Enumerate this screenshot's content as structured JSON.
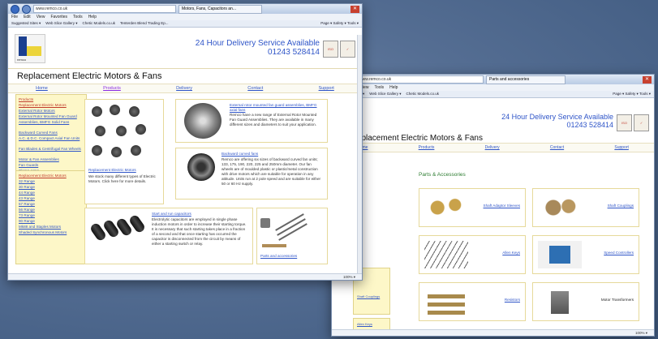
{
  "win1": {
    "address": "www.remco.co.uk",
    "tab": "Motors, Fans, Capacitors an...",
    "menu": [
      "File",
      "Edit",
      "View",
      "Favorites",
      "Tools",
      "Help"
    ],
    "favorites": [
      "Suggested Sites ▾",
      "Web Slice Gallery ▾",
      "Chetic Models.co.uk",
      "Tenterden Blend Trading Ep..."
    ],
    "toolbar_right": "Page ▾  Safety ▾  Tools ▾",
    "delivery_line1": "24 Hour Delivery Service Available",
    "delivery_phone": "01243 528414",
    "page_title": "Replacement Electric Motors & Fans",
    "nav": [
      "Home",
      "Products",
      "Delivery",
      "Contact",
      "Support"
    ],
    "products_head": "Products",
    "products": [
      "Replacement Electric Motors",
      "External Rotor Motors",
      "External Rotor Mounted Fan Guard Assemblies, BMFG Solid Fans",
      "Backward Curved Fans",
      "A.C. & D.C. Compact Axial Fan Units",
      "Fan Blades & Centrifugal Fan Wheels",
      "Motor & Fan Assemblies",
      "Fan Guards",
      "Clamp Arms",
      "Parts & Accessories"
    ],
    "motors_head": "Replacement Electric Motors",
    "motor_ranges": [
      "32 Range",
      "30 Range",
      "44 Range",
      "43 Range",
      "57 Range",
      "56 Range",
      "73 Range",
      "90 Range",
      "Mk88 and Staples Motors",
      "Shaded Synchronous Motors"
    ],
    "card1_link": "Replacement Electric Motors",
    "card1_text": "We stock many different types of Electric Motors. Click here for more details.",
    "card2_link": "External rotor mounted fan guard assemblies, BMFG axial fans",
    "card2_text": "Remco have a new range of External Rotor Mounted Fan Guard Assemblies. They are available in many different sizes and diameters to suit your application.",
    "card3_link": "Backward curved fans",
    "card3_text": "Remco are offering six sizes of backward curved fan units; 133, 175, 190, 220, 225 and 250mm diameter. Our fan wheels are of moulded plastic or plastic/metal construction with drive motors which are suitable for operation in any attitude. Units run at 2 pole speed and are suitable for either 50 or 60 Hz supply.",
    "card4_link": "Start and run capacitors",
    "card4_text": "Electrolytic capacitors are employed in single phase induction motors in order to increase their starting torque. It is necessary that such starting takes place in a fraction of a second and that once starting has occurred the capacitor is disconnected from the circuit by means of either a starting switch or relay.",
    "card5_link": "Parts and accessories",
    "zoom": "100% ▾"
  },
  "win2": {
    "address": "www.remco.co.uk",
    "tab": "Parts and accessories",
    "delivery_line1": "24 Hour Delivery Service Available",
    "delivery_phone": "01243 528414",
    "page_title": "mco Replacement Electric Motors & Fans",
    "nav": [
      "Home",
      "Products",
      "Delivery",
      "Contact",
      "Support"
    ],
    "side_links": [
      "Products",
      "Replacement Electric Motors",
      "External Rotor Motors",
      "External Rotor Mounted Fan Guard Assemblies, BMFG Solid Fans",
      "Backward Curved Fans",
      "A.C. & D.C. Compact Axial Fan Units",
      "Fan Blades & Centrifugal Fan Wheels",
      "Motor & Fan Assemblies",
      "Fan Guards",
      "Clamp Arms",
      "Parts & Accessories"
    ],
    "side_bottom": [
      "Shaft Couplings",
      "Allen Keys"
    ],
    "heading": "Parts & Accessories",
    "parts": [
      "Shaft Adaptor Sleeves",
      "Shaft Couplings",
      "Allen Keys",
      "Speed Controllers",
      "Resistors",
      "Motor Transformers"
    ],
    "zoom": "100% ▾"
  },
  "colors": {
    "link": "#2f55c8",
    "sidebar_bg": "#fdf7c8",
    "heading_green": "#2e7d32"
  }
}
